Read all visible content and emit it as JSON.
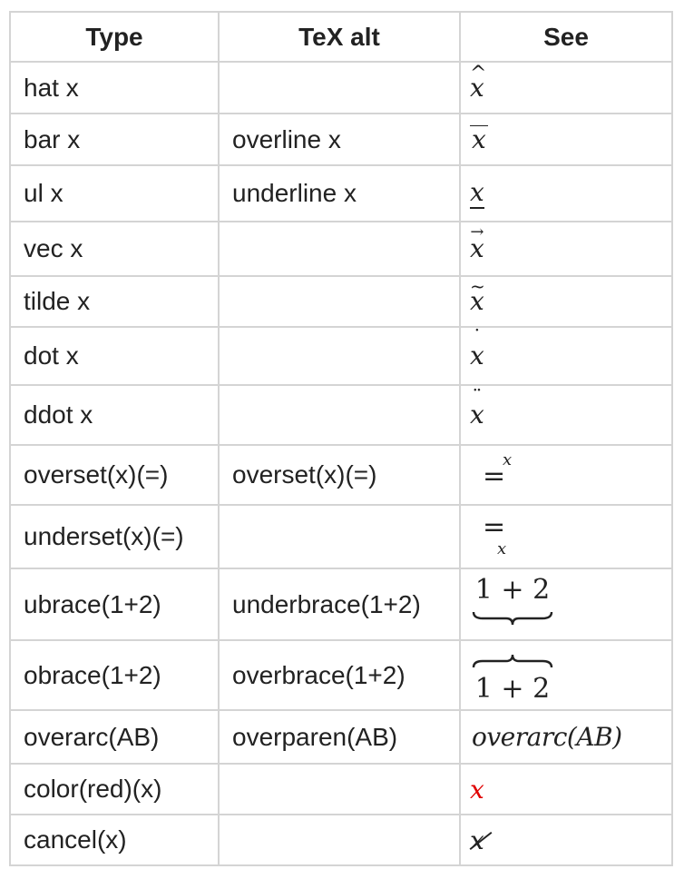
{
  "headers": {
    "type": "Type",
    "tex_alt": "TeX alt",
    "see": "See"
  },
  "rows": [
    {
      "type": "hat x",
      "tex_alt": "",
      "see": "x"
    },
    {
      "type": "bar x",
      "tex_alt": "overline x",
      "see": "x"
    },
    {
      "type": "ul x",
      "tex_alt": "underline x",
      "see": "x"
    },
    {
      "type": "vec x",
      "tex_alt": "",
      "see": "x"
    },
    {
      "type": "tilde x",
      "tex_alt": "",
      "see": "x"
    },
    {
      "type": "dot x",
      "tex_alt": "",
      "see": "x"
    },
    {
      "type": "ddot x",
      "tex_alt": "",
      "see": "x"
    },
    {
      "type": "overset(x)(=)",
      "tex_alt": "overset(x)(=)",
      "see": "=",
      "see_script": "x"
    },
    {
      "type": "underset(x)(=)",
      "tex_alt": "",
      "see": "=",
      "see_script": "x"
    },
    {
      "type": "ubrace(1+2)",
      "tex_alt": "underbrace(1+2)",
      "see": "1 + 2"
    },
    {
      "type": "obrace(1+2)",
      "tex_alt": "overbrace(1+2)",
      "see": "1 + 2"
    },
    {
      "type": "overarc(AB)",
      "tex_alt": "overparen(AB)",
      "see": "overarc(AB)"
    },
    {
      "type": "color(red)(x)",
      "tex_alt": "",
      "see": "x",
      "see_color": "#e00000"
    },
    {
      "type": "cancel(x)",
      "tex_alt": "",
      "see": "x"
    }
  ]
}
